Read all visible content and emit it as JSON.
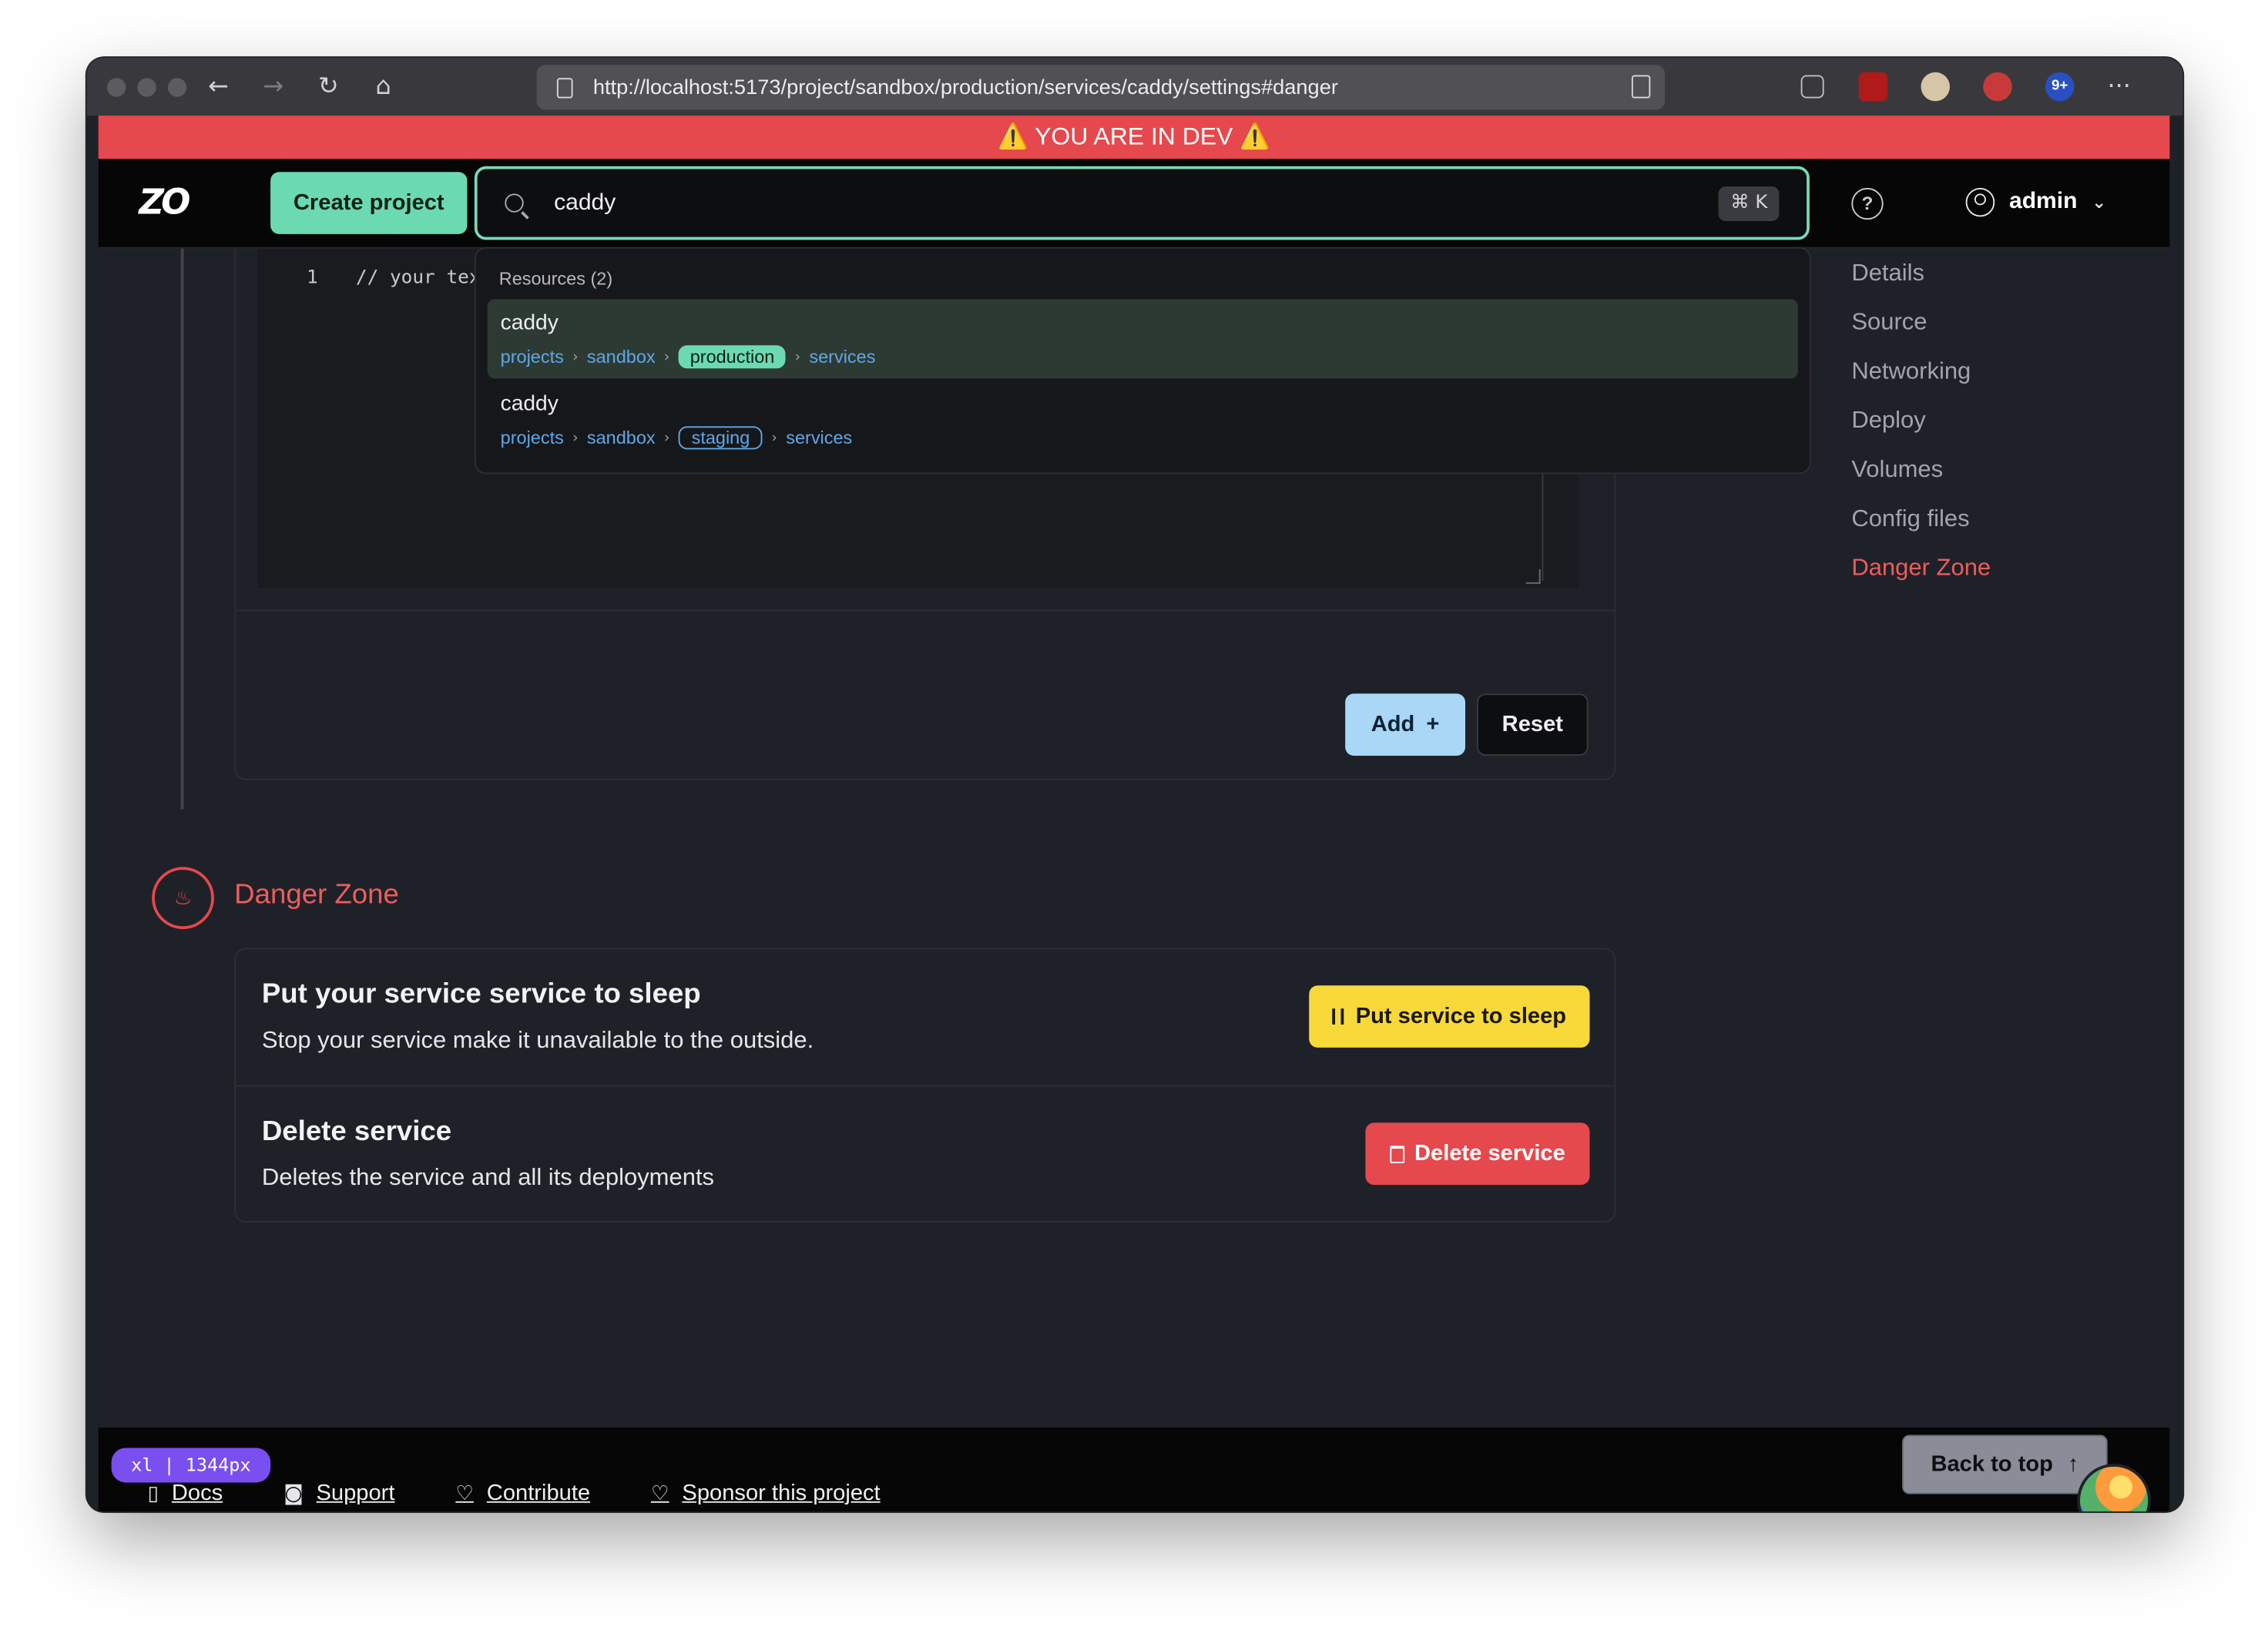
{
  "browser": {
    "url": "http://localhost:5173/project/sandbox/production/services/caddy/settings#danger",
    "nav_back": "←",
    "nav_forward": "→",
    "nav_reload": "↻",
    "nav_home": "⌂",
    "menu": "···",
    "ext_badge": "9+"
  },
  "banner": {
    "text": "⚠️ YOU ARE IN DEV ⚠️",
    "color": "#e5484d"
  },
  "header": {
    "logo": "ZO",
    "create_project": "Create project",
    "search_value": "caddy",
    "search_shortcut": "⌘ K",
    "help": "?",
    "user": "admin",
    "user_chevron": "⌄"
  },
  "search_results": {
    "heading": "Resources (2)",
    "items": [
      {
        "name": "caddy",
        "crumbs": [
          "projects",
          "sandbox"
        ],
        "env": "production",
        "last": "services",
        "selected": true
      },
      {
        "name": "caddy",
        "crumbs": [
          "projects",
          "sandbox"
        ],
        "env": "staging",
        "last": "services",
        "selected": false
      }
    ]
  },
  "editor": {
    "line_number": "1",
    "code": "// your tex"
  },
  "config_card": {
    "add_label": "Add",
    "add_icon": "+",
    "reset_label": "Reset"
  },
  "danger_zone": {
    "title": "Danger Zone",
    "icon": "♨",
    "sleep": {
      "title": "Put your service service to sleep",
      "description": "Stop your service make it unavailable to the outside.",
      "button": "Put service to sleep"
    },
    "delete": {
      "title": "Delete service",
      "description": "Deletes the service and all its deployments",
      "button": "Delete service"
    }
  },
  "toc": {
    "items": [
      "Details",
      "Source",
      "Networking",
      "Deploy",
      "Volumes",
      "Config files",
      "Danger Zone"
    ],
    "active": "Danger Zone"
  },
  "footer": {
    "breakpoint": "xl | 1344px",
    "links": [
      {
        "label": "Docs",
        "icon": "book-icon"
      },
      {
        "label": "Support",
        "icon": "discord-icon"
      },
      {
        "label": "Contribute",
        "icon": "heart-handshake-icon"
      },
      {
        "label": "Sponsor this project",
        "icon": "heart-icon"
      }
    ],
    "back_to_top": "Back to top",
    "back_to_top_icon": "↑"
  },
  "colors": {
    "accent_green": "#6bdab0",
    "danger_red": "#e5484d",
    "warning_yellow": "#f7d93a",
    "info_blue": "#a9d7f5",
    "link_blue": "#5fa8e8"
  }
}
